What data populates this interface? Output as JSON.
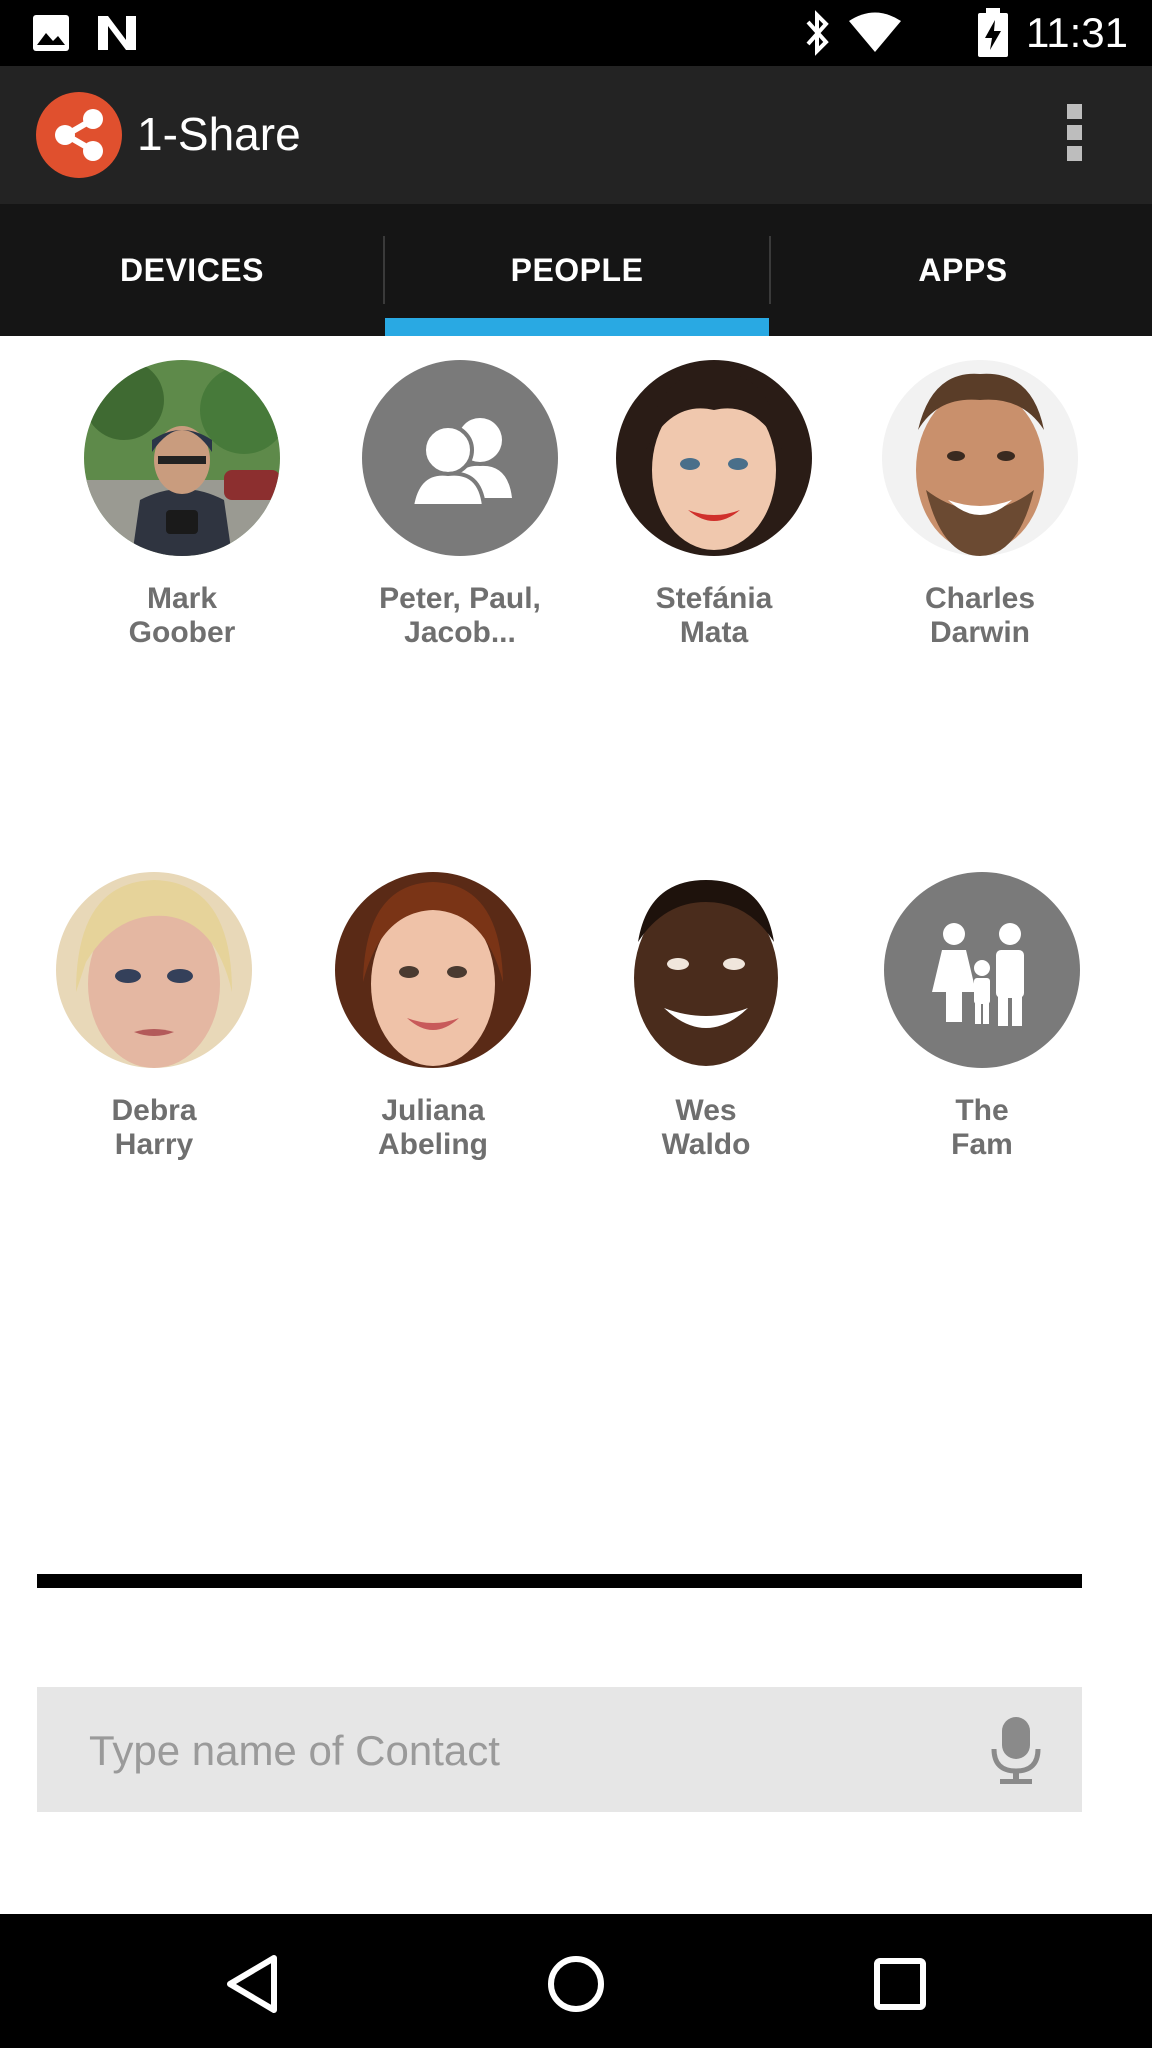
{
  "status_bar": {
    "time": "11:31",
    "icons": [
      "gallery-icon",
      "n-icon",
      "bluetooth-icon",
      "wifi-icon",
      "battery-charging-icon"
    ]
  },
  "app_bar": {
    "title": "1-Share",
    "logo_icon": "share-icon",
    "overflow_icon": "more-vert-icon"
  },
  "tabs": [
    {
      "label": "DEVICES",
      "selected": false
    },
    {
      "label": "PEOPLE",
      "selected": true
    },
    {
      "label": "APPS",
      "selected": false
    }
  ],
  "contacts": [
    {
      "name_line1": "Mark",
      "name_line2": "Goober",
      "avatar": "photo"
    },
    {
      "name_line1": "Peter, Paul,",
      "name_line2": "Jacob...",
      "avatar": "group-icon"
    },
    {
      "name_line1": "Stefánia",
      "name_line2": "Mata",
      "avatar": "photo"
    },
    {
      "name_line1": "Charles",
      "name_line2": "Darwin",
      "avatar": "photo"
    },
    {
      "name_line1": "Debra",
      "name_line2": "Harry",
      "avatar": "photo"
    },
    {
      "name_line1": "Juliana",
      "name_line2": "Abeling",
      "avatar": "photo"
    },
    {
      "name_line1": "Wes",
      "name_line2": "Waldo",
      "avatar": "photo"
    },
    {
      "name_line1": "The",
      "name_line2": "Fam",
      "avatar": "family-icon"
    }
  ],
  "search": {
    "placeholder": "Type name of Contact",
    "value": ""
  },
  "nav_bar": {
    "back": "back-icon",
    "home": "home-icon",
    "recents": "recents-icon"
  },
  "colors": {
    "accent": "#29a9e3",
    "logo": "#e0502e",
    "group_avatar": "#7a7a7a"
  }
}
